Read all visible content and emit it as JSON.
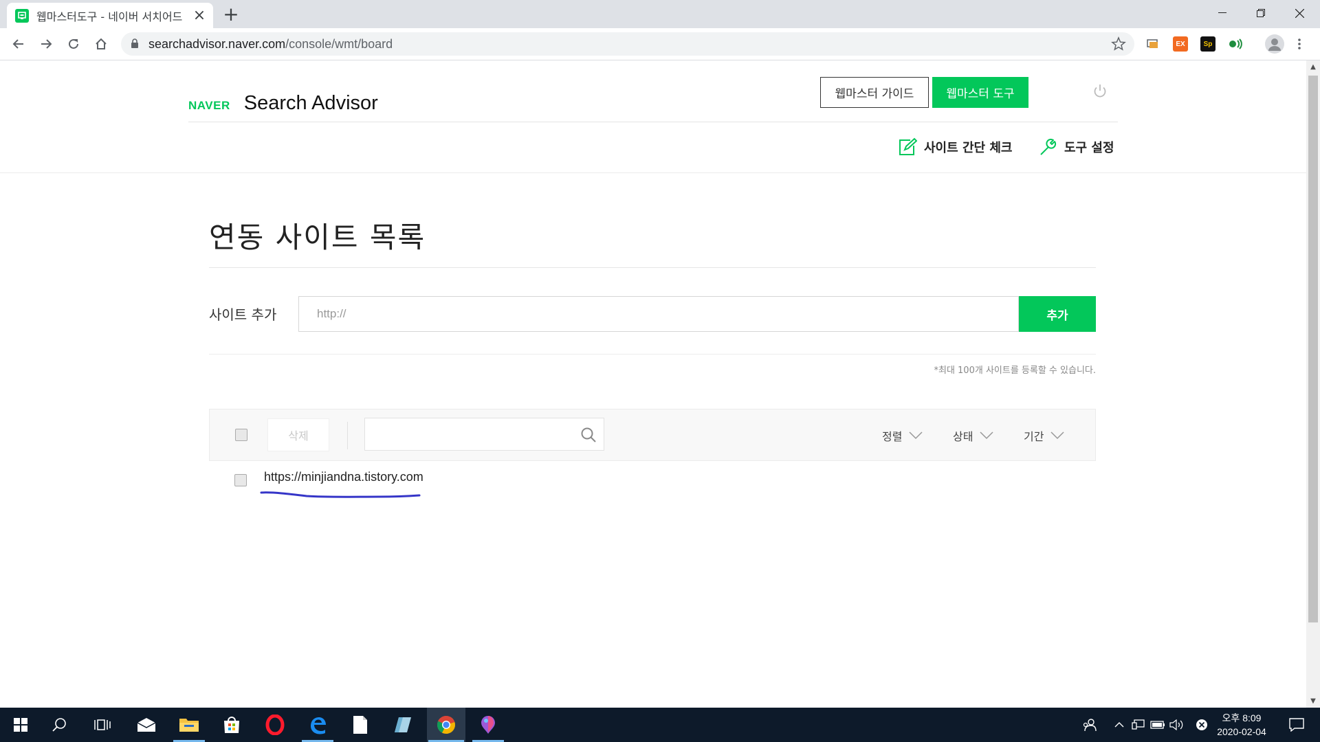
{
  "browser": {
    "tab_title": "웹마스터도구 - 네이버 서치어드",
    "url_host": "searchadvisor.naver.com",
    "url_path": "/console/wmt/board"
  },
  "header": {
    "logo_naver": "NAVER",
    "logo_product": "Search Advisor",
    "guide_button": "웹마스터 가이드",
    "tool_button": "웹마스터 도구",
    "site_check_link": "사이트 간단 체크",
    "tool_settings_link": "도구 설정"
  },
  "main": {
    "page_title": "연동 사이트 목록",
    "add_label": "사이트 추가",
    "add_placeholder": "http://",
    "add_button": "추가",
    "notice": "*최대 100개 사이트를 등록할 수 있습니다.",
    "delete_button": "삭제",
    "sort_label": "정렬",
    "status_label": "상태",
    "period_label": "기간",
    "sites": [
      {
        "url": "https://minjiandna.tistory.com"
      }
    ]
  },
  "taskbar": {
    "time_period": "오후 8:09",
    "date": "2020-02-04"
  },
  "colors": {
    "naver_green": "#03c75a",
    "annotation_blue": "#3535c8",
    "taskbar_bg": "#0d1a2a"
  }
}
